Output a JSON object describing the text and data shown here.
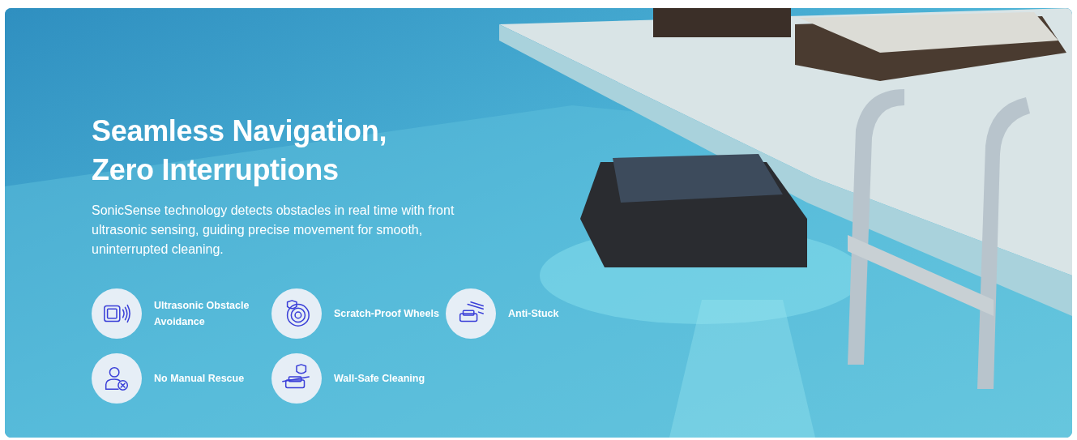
{
  "hero": {
    "title": "Seamless Navigation,\nZero Interruptions",
    "description": "SonicSense technology detects obstacles in real time with front ultrasonic sensing, guiding precise movement for smooth, uninterrupted cleaning."
  },
  "features": [
    {
      "kind": "sonar",
      "label": "Ultrasonic Obstacle Avoidance"
    },
    {
      "kind": "wheel",
      "label": "Scratch-Proof Wheels"
    },
    {
      "kind": "robot",
      "label": "Anti-Stuck"
    },
    {
      "kind": "person",
      "label": "No Manual Rescue"
    },
    {
      "kind": "shield",
      "label": "Wall-Safe Cleaning"
    }
  ]
}
